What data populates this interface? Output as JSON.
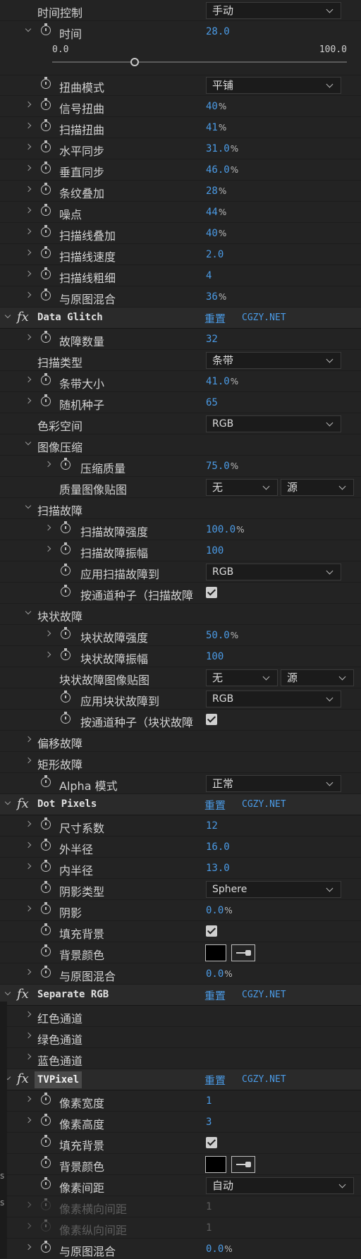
{
  "left_edge_glyphs": [
    "s",
    "s"
  ],
  "sections": {
    "top": {
      "time_control": {
        "label": "时间控制",
        "value": "手动"
      },
      "time": {
        "label": "时间",
        "value": "28.0"
      },
      "time_slider": {
        "min": "0.0",
        "max": "100.0",
        "fraction": 0.28
      },
      "warp_mode": {
        "label": "扭曲模式",
        "value": "平铺"
      },
      "signal_warp": {
        "label": "信号扭曲",
        "value": "40",
        "unit": "%"
      },
      "scan_warp": {
        "label": "扫描扭曲",
        "value": "41",
        "unit": "%"
      },
      "h_sync": {
        "label": "水平同步",
        "value": "31.0",
        "unit": "%"
      },
      "v_sync": {
        "label": "垂直同步",
        "value": "46.0",
        "unit": "%"
      },
      "stripe_overlay": {
        "label": "条纹叠加",
        "value": "28",
        "unit": "%"
      },
      "noise": {
        "label": "噪点",
        "value": "44",
        "unit": "%"
      },
      "scanline_overlay": {
        "label": "扫描线叠加",
        "value": "40",
        "unit": "%"
      },
      "scanline_speed": {
        "label": "扫描线速度",
        "value": "2.0"
      },
      "scanline_thickness": {
        "label": "扫描线粗细",
        "value": "4"
      },
      "blend": {
        "label": "与原图混合",
        "value": "36",
        "unit": "%"
      }
    },
    "data_glitch": {
      "name": "Data Glitch",
      "reset": "重置",
      "site": "CGZY.NET",
      "glitch_count": {
        "label": "故障数量",
        "value": "32"
      },
      "scan_type": {
        "label": "扫描类型",
        "value": "条带"
      },
      "band_size": {
        "label": "条带大小",
        "value": "41.0",
        "unit": "%"
      },
      "random_seed": {
        "label": "随机种子",
        "value": "65"
      },
      "color_space": {
        "label": "色彩空间",
        "value": "RGB"
      },
      "image_compression": {
        "label": "图像压缩"
      },
      "compression_quality": {
        "label": "压缩质量",
        "value": "75.0",
        "unit": "%"
      },
      "quality_map": {
        "label": "质量图像贴图",
        "value1": "无",
        "value2": "源"
      },
      "scan_glitch": {
        "label": "扫描故障"
      },
      "scan_glitch_strength": {
        "label": "扫描故障强度",
        "value": "100.0",
        "unit": "%"
      },
      "scan_glitch_amplitude": {
        "label": "扫描故障振幅",
        "value": "100"
      },
      "apply_scan_glitch": {
        "label": "应用扫描故障到",
        "value": "RGB"
      },
      "scan_channel_seed": {
        "label": "按通道种子（扫描故障"
      },
      "block_glitch": {
        "label": "块状故障"
      },
      "block_glitch_strength": {
        "label": "块状故障强度",
        "value": "50.0",
        "unit": "%"
      },
      "block_glitch_amplitude": {
        "label": "块状故障振幅",
        "value": "100"
      },
      "block_map": {
        "label": "块状故障图像贴图",
        "value1": "无",
        "value2": "源"
      },
      "apply_block_glitch": {
        "label": "应用块状故障到",
        "value": "RGB"
      },
      "block_channel_seed": {
        "label": "按通道种子（块状故障"
      },
      "offset_glitch": {
        "label": "偏移故障"
      },
      "rect_glitch": {
        "label": "矩形故障"
      },
      "alpha_mode": {
        "label": "Alpha 模式",
        "value": "正常"
      }
    },
    "dot_pixels": {
      "name": "Dot Pixels",
      "reset": "重置",
      "site": "CGZY.NET",
      "size_factor": {
        "label": "尺寸系数",
        "value": "12"
      },
      "outer_radius": {
        "label": "外半径",
        "value": "16.0"
      },
      "inner_radius": {
        "label": "内半径",
        "value": "13.0"
      },
      "shadow_type": {
        "label": "阴影类型",
        "value": "Sphere"
      },
      "shadow": {
        "label": "阴影",
        "value": "0.0",
        "unit": "%"
      },
      "fill_bg": {
        "label": "填充背景"
      },
      "bg_color": {
        "label": "背景颜色",
        "color": "#000000"
      },
      "blend": {
        "label": "与原图混合",
        "value": "0.0",
        "unit": "%"
      }
    },
    "separate_rgb": {
      "name": "Separate RGB",
      "reset": "重置",
      "site": "CGZY.NET",
      "red": {
        "label": "红色通道"
      },
      "green": {
        "label": "绿色通道"
      },
      "blue": {
        "label": "蓝色通道"
      }
    },
    "tvpixel": {
      "name": "TVPixel",
      "reset": "重置",
      "site": "CGZY.NET",
      "pixel_width": {
        "label": "像素宽度",
        "value": "1"
      },
      "pixel_height": {
        "label": "像素高度",
        "value": "3"
      },
      "fill_bg": {
        "label": "填充背景"
      },
      "bg_color": {
        "label": "背景颜色",
        "color": "#000000"
      },
      "pixel_spacing": {
        "label": "像素间距",
        "value": "自动"
      },
      "h_spacing": {
        "label": "像素横向间距",
        "value": "1"
      },
      "v_spacing": {
        "label": "像素纵向间距",
        "value": "1"
      },
      "blend": {
        "label": "与原图混合",
        "value": "0.0",
        "unit": "%"
      }
    }
  }
}
